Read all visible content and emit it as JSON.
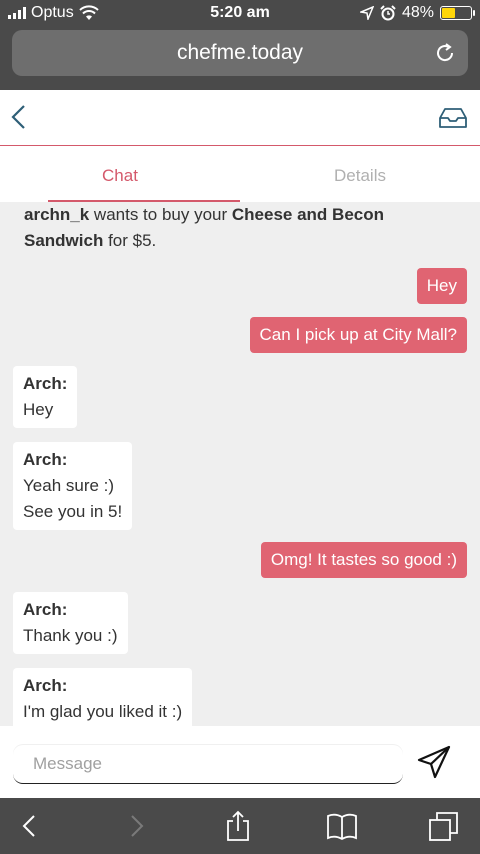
{
  "status_bar": {
    "carrier": "Optus",
    "time": "5:20 am",
    "battery": "48%",
    "battery_level": 0.48
  },
  "browser": {
    "url": "chefme.today"
  },
  "tabs": [
    {
      "label": "Chat",
      "active": true
    },
    {
      "label": "Details",
      "active": false
    }
  ],
  "offer": {
    "user": "archn_k",
    "middle": " wants to buy your ",
    "item": "Cheese and Becon Sandwich",
    "price_text": " for $5."
  },
  "messages": [
    {
      "from": "me",
      "text": "Hey"
    },
    {
      "from": "me",
      "text": "Can I pick up at City Mall?"
    },
    {
      "from": "them",
      "sender": "Arch:",
      "lines": [
        "Hey"
      ]
    },
    {
      "from": "them",
      "sender": "Arch:",
      "lines": [
        "Yeah sure :)",
        "See you in 5!"
      ]
    },
    {
      "from": "me",
      "text": "Omg! It tastes so good :)"
    },
    {
      "from": "them",
      "sender": "Arch:",
      "lines": [
        "Thank you :)"
      ]
    },
    {
      "from": "them",
      "sender": "Arch:",
      "lines": [
        "I'm glad you liked it :)"
      ]
    }
  ],
  "composer": {
    "placeholder": "Message"
  },
  "colors": {
    "accent": "#d4596b",
    "outgoing_bubble": "#e06472",
    "chrome": "#4a4a4a"
  }
}
